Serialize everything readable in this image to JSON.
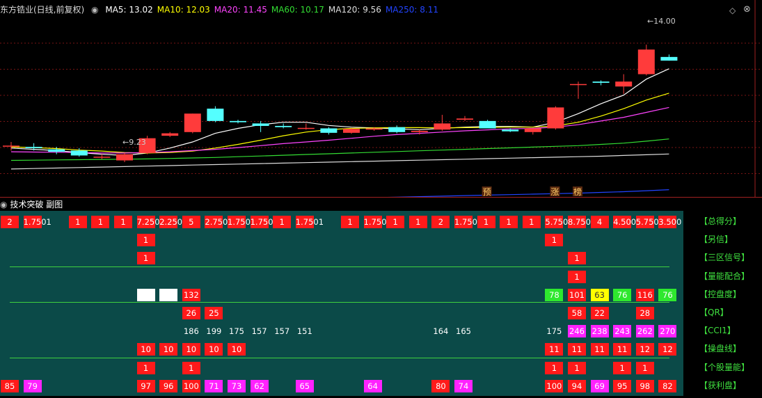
{
  "header": {
    "title": "东方锆业(日线,前复权)",
    "ma_items": [
      {
        "label": "MA5: 13.02",
        "color": "#ffffff"
      },
      {
        "label": "MA10: 12.03",
        "color": "#ffff00"
      },
      {
        "label": "MA20: 11.45",
        "color": "#ff44ff"
      },
      {
        "label": "MA60: 10.17",
        "color": "#33dd33"
      },
      {
        "label": "MA120: 9.56",
        "color": "#dddddd"
      },
      {
        "label": "MA250: 8.11",
        "color": "#2244ff"
      }
    ]
  },
  "chart_data": {
    "type": "candlestick",
    "price_labels": {
      "high": "14.00",
      "low": "9.23"
    },
    "candles": [
      {
        "o": 9.9,
        "h": 10.05,
        "l": 9.7,
        "c": 9.9
      },
      {
        "o": 9.85,
        "h": 10.0,
        "l": 9.7,
        "c": 9.8
      },
      {
        "o": 9.75,
        "h": 9.85,
        "l": 9.55,
        "c": 9.65
      },
      {
        "o": 9.7,
        "h": 9.8,
        "l": 9.45,
        "c": 9.5
      },
      {
        "o": 9.45,
        "h": 9.55,
        "l": 9.35,
        "c": 9.45
      },
      {
        "o": 9.3,
        "h": 9.6,
        "l": 9.23,
        "c": 9.55
      },
      {
        "o": 9.6,
        "h": 10.3,
        "l": 9.55,
        "c": 10.2
      },
      {
        "o": 10.3,
        "h": 10.45,
        "l": 10.25,
        "c": 10.4
      },
      {
        "o": 10.45,
        "h": 11.2,
        "l": 10.4,
        "c": 11.2
      },
      {
        "o": 11.4,
        "h": 11.5,
        "l": 10.85,
        "c": 10.9
      },
      {
        "o": 10.9,
        "h": 10.95,
        "l": 10.8,
        "c": 10.85
      },
      {
        "o": 10.8,
        "h": 10.9,
        "l": 10.45,
        "c": 10.7
      },
      {
        "o": 10.7,
        "h": 10.8,
        "l": 10.6,
        "c": 10.65
      },
      {
        "o": 10.6,
        "h": 10.8,
        "l": 10.55,
        "c": 10.62
      },
      {
        "o": 10.6,
        "h": 10.65,
        "l": 10.35,
        "c": 10.42
      },
      {
        "o": 10.42,
        "h": 10.6,
        "l": 10.38,
        "c": 10.58
      },
      {
        "o": 10.55,
        "h": 10.65,
        "l": 10.5,
        "c": 10.6
      },
      {
        "o": 10.65,
        "h": 10.72,
        "l": 10.4,
        "c": 10.45
      },
      {
        "o": 10.45,
        "h": 10.55,
        "l": 10.35,
        "c": 10.5
      },
      {
        "o": 10.55,
        "h": 11.15,
        "l": 10.5,
        "c": 10.8
      },
      {
        "o": 10.95,
        "h": 11.1,
        "l": 10.9,
        "c": 11.0
      },
      {
        "o": 10.9,
        "h": 10.95,
        "l": 10.6,
        "c": 10.6
      },
      {
        "o": 10.55,
        "h": 10.6,
        "l": 10.45,
        "c": 10.48
      },
      {
        "o": 10.45,
        "h": 10.6,
        "l": 10.35,
        "c": 10.6
      },
      {
        "o": 10.6,
        "h": 11.5,
        "l": 10.55,
        "c": 11.45
      },
      {
        "o": 12.4,
        "h": 12.5,
        "l": 11.8,
        "c": 12.4
      },
      {
        "o": 12.5,
        "h": 12.55,
        "l": 12.35,
        "c": 12.45
      },
      {
        "o": 12.3,
        "h": 12.8,
        "l": 12.0,
        "c": 12.5
      },
      {
        "o": 12.8,
        "h": 14.0,
        "l": 12.75,
        "c": 13.8
      },
      {
        "o": 13.5,
        "h": 13.6,
        "l": 13.35,
        "c": 13.35
      }
    ],
    "ma_lines": [
      {
        "name": "MA5",
        "color": "#ffffff",
        "values": [
          9.8,
          9.75,
          9.7,
          9.62,
          9.55,
          9.5,
          9.6,
          9.8,
          10.05,
          10.4,
          10.6,
          10.75,
          10.85,
          10.85,
          10.72,
          10.65,
          10.62,
          10.58,
          10.55,
          10.6,
          10.65,
          10.68,
          10.68,
          10.65,
          10.85,
          11.2,
          11.6,
          11.95,
          12.6,
          13.02
        ]
      },
      {
        "name": "MA10",
        "color": "#ffff00",
        "values": [
          9.85,
          9.82,
          9.78,
          9.72,
          9.68,
          9.62,
          9.6,
          9.62,
          9.68,
          9.8,
          9.95,
          10.12,
          10.3,
          10.45,
          10.55,
          10.6,
          10.62,
          10.63,
          10.63,
          10.62,
          10.63,
          10.64,
          10.65,
          10.65,
          10.7,
          10.85,
          11.1,
          11.4,
          11.75,
          12.03
        ]
      },
      {
        "name": "MA20",
        "color": "#ff44ff",
        "values": [
          9.65,
          9.64,
          9.63,
          9.62,
          9.6,
          9.6,
          9.62,
          9.65,
          9.7,
          9.75,
          9.82,
          9.9,
          9.98,
          10.05,
          10.12,
          10.2,
          10.28,
          10.35,
          10.4,
          10.45,
          10.5,
          10.54,
          10.58,
          10.6,
          10.65,
          10.75,
          10.9,
          11.05,
          11.25,
          11.45
        ]
      },
      {
        "name": "MA60",
        "color": "#33dd33",
        "values": [
          9.3,
          9.31,
          9.32,
          9.33,
          9.34,
          9.35,
          9.36,
          9.38,
          9.4,
          9.42,
          9.45,
          9.48,
          9.51,
          9.54,
          9.57,
          9.6,
          9.63,
          9.66,
          9.69,
          9.72,
          9.75,
          9.78,
          9.81,
          9.84,
          9.87,
          9.9,
          9.95,
          10.0,
          10.08,
          10.17
        ]
      },
      {
        "name": "MA120",
        "color": "#dddddd",
        "values": [
          8.95,
          8.97,
          8.99,
          9.01,
          9.03,
          9.05,
          9.07,
          9.09,
          9.11,
          9.13,
          9.15,
          9.17,
          9.19,
          9.21,
          9.23,
          9.25,
          9.27,
          9.29,
          9.31,
          9.33,
          9.35,
          9.37,
          9.39,
          9.41,
          9.43,
          9.45,
          9.47,
          9.5,
          9.53,
          9.56
        ]
      },
      {
        "name": "MA250",
        "color": "#2244ff",
        "values": [
          7.45,
          7.47,
          7.49,
          7.52,
          7.55,
          7.57,
          7.59,
          7.61,
          7.63,
          7.65,
          7.67,
          7.69,
          7.71,
          7.73,
          7.75,
          7.77,
          7.79,
          7.81,
          7.83,
          7.85,
          7.87,
          7.89,
          7.91,
          7.93,
          7.95,
          7.97,
          8.0,
          8.03,
          8.07,
          8.11
        ]
      }
    ],
    "markers": [
      {
        "label": "预",
        "candle": 21
      },
      {
        "label": "涨",
        "candle": 24
      },
      {
        "label": "榜",
        "candle": 25
      }
    ]
  },
  "sub_panel": {
    "title": "技术突破 副图",
    "rows": [
      {
        "label": "【总得分】",
        "cells": [
          [
            "2",
            "red"
          ],
          [
            "1.75",
            "red"
          ],
          [
            "01",
            "red"
          ],
          [
            "1",
            "red"
          ],
          [
            "1",
            "red"
          ],
          [
            "1",
            "red"
          ],
          [
            "7.25",
            "red"
          ],
          [
            "02.25",
            "red"
          ],
          [
            "05",
            "red"
          ],
          [
            "",
            "none"
          ],
          [
            "2.75",
            "red"
          ],
          [
            "01.75",
            "red"
          ],
          [
            "01.75",
            "red"
          ],
          [
            "01",
            "red"
          ],
          [
            "1.75",
            "red"
          ],
          [
            "01",
            "red"
          ],
          [
            "1",
            "red"
          ],
          [
            "1.75",
            "red"
          ],
          [
            "01",
            "red"
          ],
          [
            "1",
            "red"
          ],
          [
            "2",
            "red"
          ],
          [
            "1.75",
            "red"
          ],
          [
            "01",
            "red"
          ],
          [
            "1",
            "red"
          ],
          [
            "1",
            "red"
          ],
          [
            "5.75",
            "red"
          ],
          [
            "08.75",
            "red"
          ],
          [
            "04",
            "red"
          ],
          [
            "4.5",
            "red"
          ],
          [
            "05.75",
            "red"
          ],
          [
            "03.5",
            "red"
          ],
          [
            "00",
            "red"
          ]
        ]
      },
      {
        "label": "【另信】",
        "cells": []
      },
      {
        "label": "【三区信号】",
        "cells": []
      },
      {
        "label": "【量能配合】",
        "cells": []
      },
      {
        "label": "【控盘度】",
        "cells": []
      },
      {
        "label": "【QR】",
        "cells": []
      },
      {
        "label": "【CCI1】",
        "cells": []
      },
      {
        "label": "【操盘线】",
        "cells": []
      },
      {
        "label": "【个股量能】",
        "cells": []
      },
      {
        "label": "【获利盘】",
        "cells": []
      }
    ],
    "grid": [
      [
        {
          "c": 0,
          "v": "2",
          "k": "red"
        },
        {
          "c": 1,
          "v": "1.7501",
          "k": "red"
        },
        {
          "c": 3,
          "v": "1",
          "k": "red"
        },
        {
          "c": 4,
          "v": "1",
          "k": "red"
        },
        {
          "c": 5,
          "v": "1",
          "k": "red"
        },
        {
          "c": 6,
          "v": "7.250",
          "k": "red"
        },
        {
          "c": 7,
          "v": "2.250",
          "k": "red"
        },
        {
          "c": 8,
          "v": "5",
          "k": "red"
        },
        {
          "c": 9,
          "v": "2.750",
          "k": "red"
        },
        {
          "c": 10,
          "v": "1.750",
          "k": "red"
        },
        {
          "c": 11,
          "v": "1.750",
          "k": "red"
        },
        {
          "c": 12,
          "v": "1",
          "k": "red"
        },
        {
          "c": 13,
          "v": "1.7501",
          "k": "red"
        },
        {
          "c": 15,
          "v": "1",
          "k": "red"
        },
        {
          "c": 16,
          "v": "1.750",
          "k": "red"
        },
        {
          "c": 17,
          "v": "1",
          "k": "red"
        },
        {
          "c": 18,
          "v": "1",
          "k": "red"
        },
        {
          "c": 19,
          "v": "2",
          "k": "red"
        },
        {
          "c": 20,
          "v": "1.750",
          "k": "red"
        },
        {
          "c": 21,
          "v": "1",
          "k": "red"
        },
        {
          "c": 22,
          "v": "1",
          "k": "red"
        },
        {
          "c": 23,
          "v": "1",
          "k": "red"
        },
        {
          "c": 24,
          "v": "5.750",
          "k": "red"
        },
        {
          "c": 25,
          "v": "8.750",
          "k": "red"
        },
        {
          "c": 26,
          "v": "4",
          "k": "red"
        },
        {
          "c": 27,
          "v": "4.500",
          "k": "red"
        },
        {
          "c": 28,
          "v": "5.750",
          "k": "red"
        },
        {
          "c": 29,
          "v": "3.500",
          "k": "red"
        }
      ],
      [
        {
          "c": 6,
          "v": "1",
          "k": "red"
        },
        {
          "c": 24,
          "v": "1",
          "k": "red"
        }
      ],
      [
        {
          "c": 6,
          "v": "1",
          "k": "red"
        },
        {
          "c": 25,
          "v": "1",
          "k": "red"
        }
      ],
      [
        {
          "c": 25,
          "v": "1",
          "k": "red"
        }
      ],
      [
        {
          "c": 6,
          "v": "",
          "k": "white"
        },
        {
          "c": 7,
          "v": "",
          "k": "white"
        },
        {
          "c": 8,
          "v": "132",
          "k": "red"
        },
        {
          "c": 24,
          "v": "78",
          "k": "green"
        },
        {
          "c": 25,
          "v": "101",
          "k": "red"
        },
        {
          "c": 26,
          "v": "63",
          "k": "yellow"
        },
        {
          "c": 27,
          "v": "76",
          "k": "green"
        },
        {
          "c": 28,
          "v": "116",
          "k": "red"
        },
        {
          "c": 29,
          "v": "76",
          "k": "green"
        }
      ],
      [
        {
          "c": 8,
          "v": "26",
          "k": "red"
        },
        {
          "c": 9,
          "v": "25",
          "k": "red"
        },
        {
          "c": 25,
          "v": "58",
          "k": "red"
        },
        {
          "c": 26,
          "v": "22",
          "k": "red"
        },
        {
          "c": 28,
          "v": "28",
          "k": "red"
        }
      ],
      [
        {
          "c": 8,
          "v": "186",
          "k": "none"
        },
        {
          "c": 9,
          "v": "199",
          "k": "none"
        },
        {
          "c": 10,
          "v": "175",
          "k": "none"
        },
        {
          "c": 11,
          "v": "157",
          "k": "none"
        },
        {
          "c": 12,
          "v": "157",
          "k": "none"
        },
        {
          "c": 13,
          "v": "151",
          "k": "none"
        },
        {
          "c": 19,
          "v": "164",
          "k": "none"
        },
        {
          "c": 20,
          "v": "165",
          "k": "none"
        },
        {
          "c": 24,
          "v": "175",
          "k": "none"
        },
        {
          "c": 25,
          "v": "246",
          "k": "magenta"
        },
        {
          "c": 26,
          "v": "238",
          "k": "magenta"
        },
        {
          "c": 27,
          "v": "243",
          "k": "magenta"
        },
        {
          "c": 28,
          "v": "262",
          "k": "magenta"
        },
        {
          "c": 29,
          "v": "270",
          "k": "magenta"
        }
      ],
      [
        {
          "c": 6,
          "v": "10",
          "k": "red"
        },
        {
          "c": 7,
          "v": "10",
          "k": "red"
        },
        {
          "c": 8,
          "v": "10",
          "k": "red"
        },
        {
          "c": 9,
          "v": "10",
          "k": "red"
        },
        {
          "c": 10,
          "v": "10",
          "k": "red"
        },
        {
          "c": 24,
          "v": "11",
          "k": "red"
        },
        {
          "c": 25,
          "v": "11",
          "k": "red"
        },
        {
          "c": 26,
          "v": "11",
          "k": "red"
        },
        {
          "c": 27,
          "v": "11",
          "k": "red"
        },
        {
          "c": 28,
          "v": "12",
          "k": "red"
        },
        {
          "c": 29,
          "v": "12",
          "k": "red"
        }
      ],
      [
        {
          "c": 6,
          "v": "1",
          "k": "red"
        },
        {
          "c": 8,
          "v": "1",
          "k": "red"
        },
        {
          "c": 24,
          "v": "1",
          "k": "red"
        },
        {
          "c": 25,
          "v": "1",
          "k": "red"
        },
        {
          "c": 27,
          "v": "1",
          "k": "red"
        },
        {
          "c": 28,
          "v": "1",
          "k": "red"
        }
      ],
      [
        {
          "c": 0,
          "v": "85",
          "k": "red"
        },
        {
          "c": 1,
          "v": "79",
          "k": "magenta"
        },
        {
          "c": 6,
          "v": "97",
          "k": "red"
        },
        {
          "c": 7,
          "v": "96",
          "k": "red"
        },
        {
          "c": 8,
          "v": "100",
          "k": "red"
        },
        {
          "c": 9,
          "v": "71",
          "k": "magenta"
        },
        {
          "c": 10,
          "v": "73",
          "k": "magenta"
        },
        {
          "c": 11,
          "v": "62",
          "k": "magenta"
        },
        {
          "c": 13,
          "v": "65",
          "k": "magenta"
        },
        {
          "c": 16,
          "v": "64",
          "k": "magenta"
        },
        {
          "c": 19,
          "v": "80",
          "k": "red"
        },
        {
          "c": 20,
          "v": "74",
          "k": "magenta"
        },
        {
          "c": 24,
          "v": "100",
          "k": "red"
        },
        {
          "c": 25,
          "v": "94",
          "k": "red"
        },
        {
          "c": 26,
          "v": "69",
          "k": "magenta"
        },
        {
          "c": 27,
          "v": "95",
          "k": "red"
        },
        {
          "c": 28,
          "v": "98",
          "k": "red"
        },
        {
          "c": 29,
          "v": "82",
          "k": "red"
        }
      ]
    ]
  }
}
